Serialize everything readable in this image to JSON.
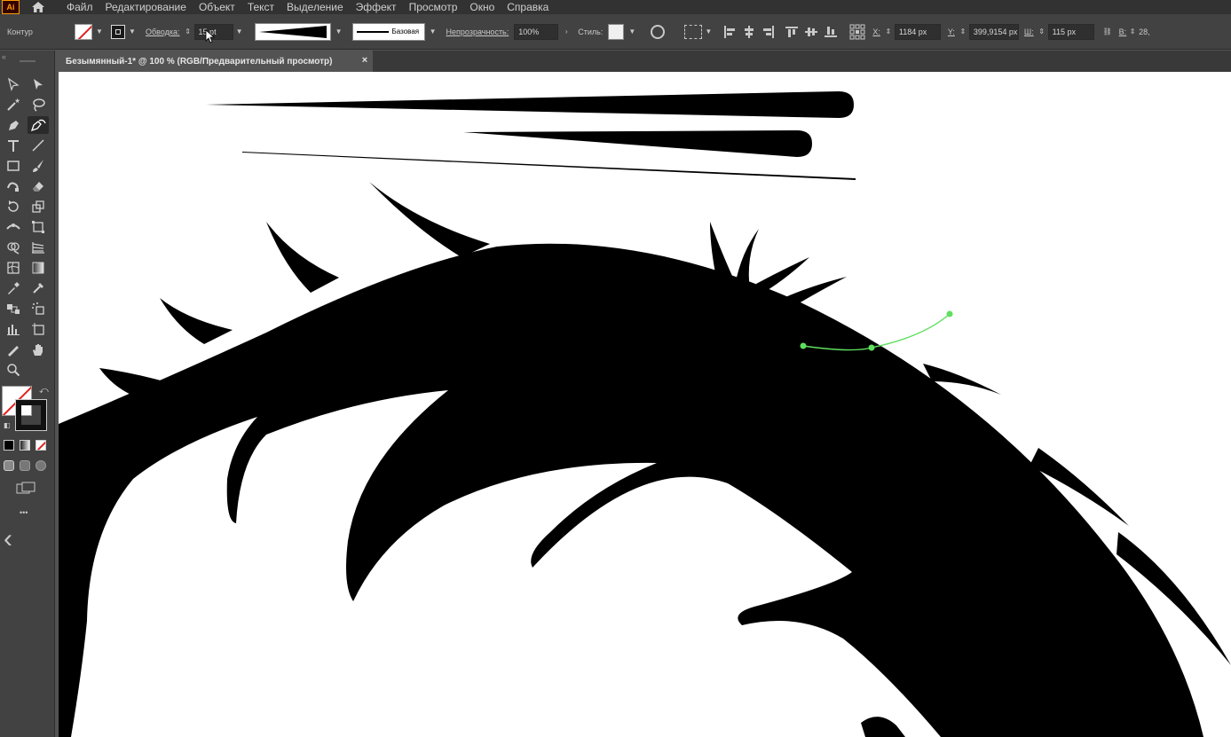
{
  "app": {
    "logo": "Ai"
  },
  "menu": {
    "items": [
      "Файл",
      "Редактирование",
      "Объект",
      "Текст",
      "Выделение",
      "Эффект",
      "Просмотр",
      "Окно",
      "Справка"
    ]
  },
  "control_bar": {
    "mode_label": "Контур",
    "stroke_label": "Обводка:",
    "stroke_weight": "15 pt",
    "brush_label": "Базовая",
    "opacity_label": "Непрозрачность:",
    "opacity_value": "100%",
    "styles_label": "Стиль:",
    "x_label": "X:",
    "x_value": "1184 px",
    "y_label": "Y:",
    "y_value": "399,9154 px",
    "w_label": "Ш:",
    "w_value": "115 px",
    "h_label": "В:",
    "h_value": "28,"
  },
  "document_tab": {
    "title": "Безымянный-1* @ 100 % (RGB/Предварительный просмотр)",
    "close_glyph": "×"
  },
  "toolbar": {
    "more_glyph": "•••",
    "collapse_glyph": "‹"
  },
  "colors": {
    "menubar_bg": "#323232",
    "panel_bg": "#424242",
    "canvas_bg": "#ffffff",
    "artwork": "#000000",
    "selection_path": "#5ee05e",
    "none_slash": "#e02020"
  }
}
